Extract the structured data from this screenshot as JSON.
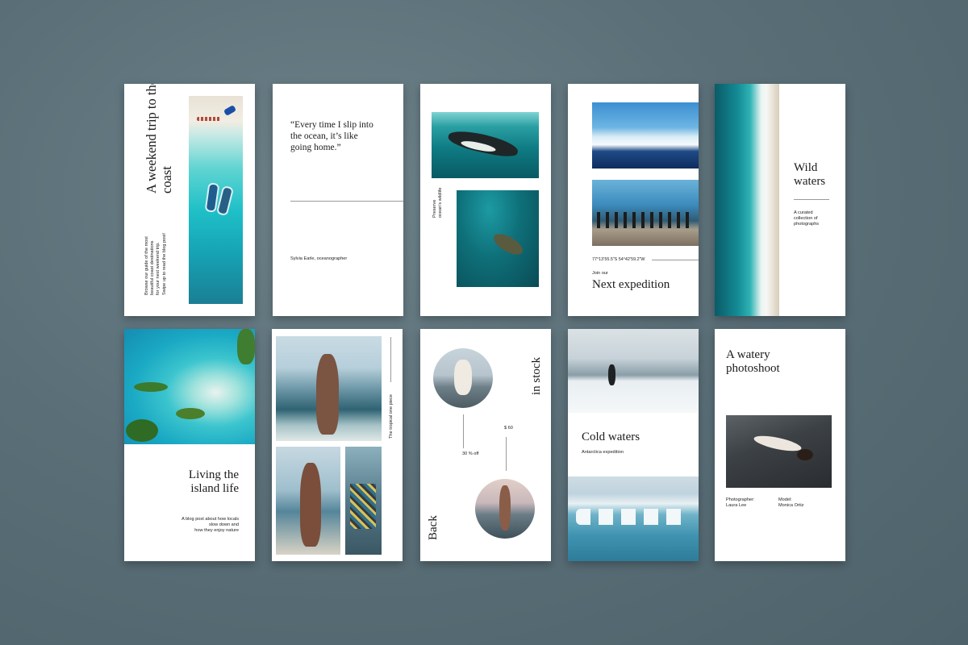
{
  "cards": {
    "weekend": {
      "title": "A weekend trip to the coast",
      "lines": [
        "Browse our guide of the most",
        "beautiful coast destinations",
        "for your next weekend trip.",
        "Swipe up to read the blog post!"
      ]
    },
    "quote": {
      "text": "“Every time I slip into the ocean, it’s like going home.”",
      "author": "Sylvia Earle, oceanographer"
    },
    "preserve": {
      "line1": "Preserve",
      "line2": "ocean’s wildlife"
    },
    "expedition": {
      "coords": "77°13’55.5”S 54°42’59.2”W",
      "kicker": "Join our",
      "title": "Next expedition"
    },
    "wild": {
      "title": "Wild waters",
      "lines": [
        "A curated",
        "collection of",
        "photographs"
      ]
    },
    "island": {
      "title": "Living the island life",
      "lines": [
        "A blog post about how locals",
        "slow down and",
        "how they enjoy nature"
      ]
    },
    "tropical": {
      "caption": "The tropical one piece"
    },
    "stock": {
      "top": "in stock",
      "bottom": "Back",
      "discount": "30 % off",
      "price": "$ 60"
    },
    "cold": {
      "title": "Cold waters",
      "subtitle": "Antarctica expedition"
    },
    "watery": {
      "title": "A watery photoshoot",
      "photographer_label": "Photographer:",
      "photographer": "Laura Lee",
      "model_label": "Model:",
      "model": "Monica Ortiz"
    }
  }
}
